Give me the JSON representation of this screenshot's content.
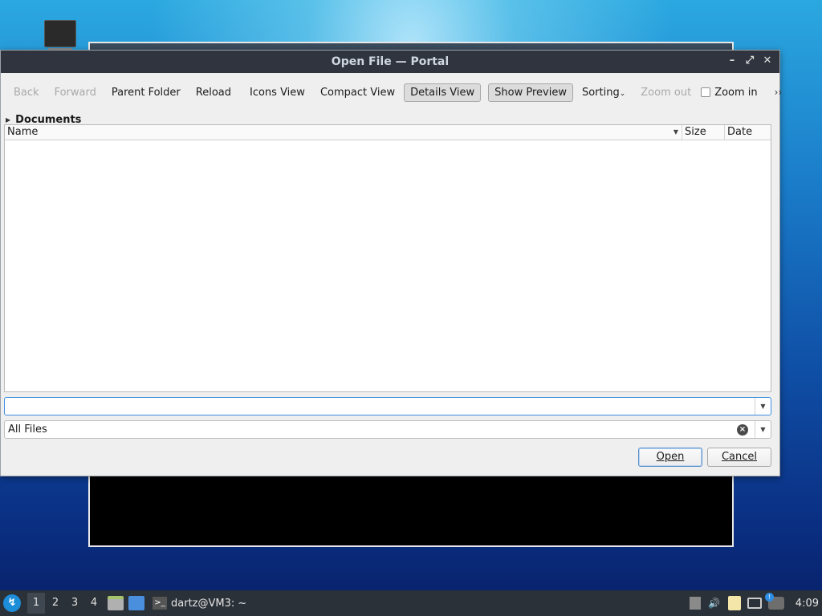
{
  "dialog": {
    "title": "Open File — Portal",
    "window_controls": [
      "minimize",
      "maximize",
      "close"
    ]
  },
  "toolbar": {
    "back": "Back",
    "forward": "Forward",
    "parent_folder": "Parent Folder",
    "reload": "Reload",
    "icons_view": "Icons View",
    "compact_view": "Compact View",
    "details_view": "Details View",
    "show_preview": "Show Preview",
    "sorting": "Sorting",
    "zoom_out": "Zoom out",
    "zoom_in": "Zoom in",
    "more": "››"
  },
  "breadcrumb": {
    "current": "Documents"
  },
  "file_list": {
    "columns": [
      "Name",
      "Size",
      "Date"
    ],
    "rows": []
  },
  "location": {
    "value": ""
  },
  "filter": {
    "value": "All Files"
  },
  "buttons": {
    "open": "Open",
    "cancel": "Cancel"
  },
  "taskbar": {
    "workspaces": [
      "1",
      "2",
      "3",
      "4"
    ],
    "active_workspace": "1",
    "task_label": "dartz@VM3: ~",
    "clock": "4:09"
  },
  "colors": {
    "titlebar": "#2f343f",
    "taskbar": "#2b3138",
    "focus_accent": "#3d8ee0"
  }
}
